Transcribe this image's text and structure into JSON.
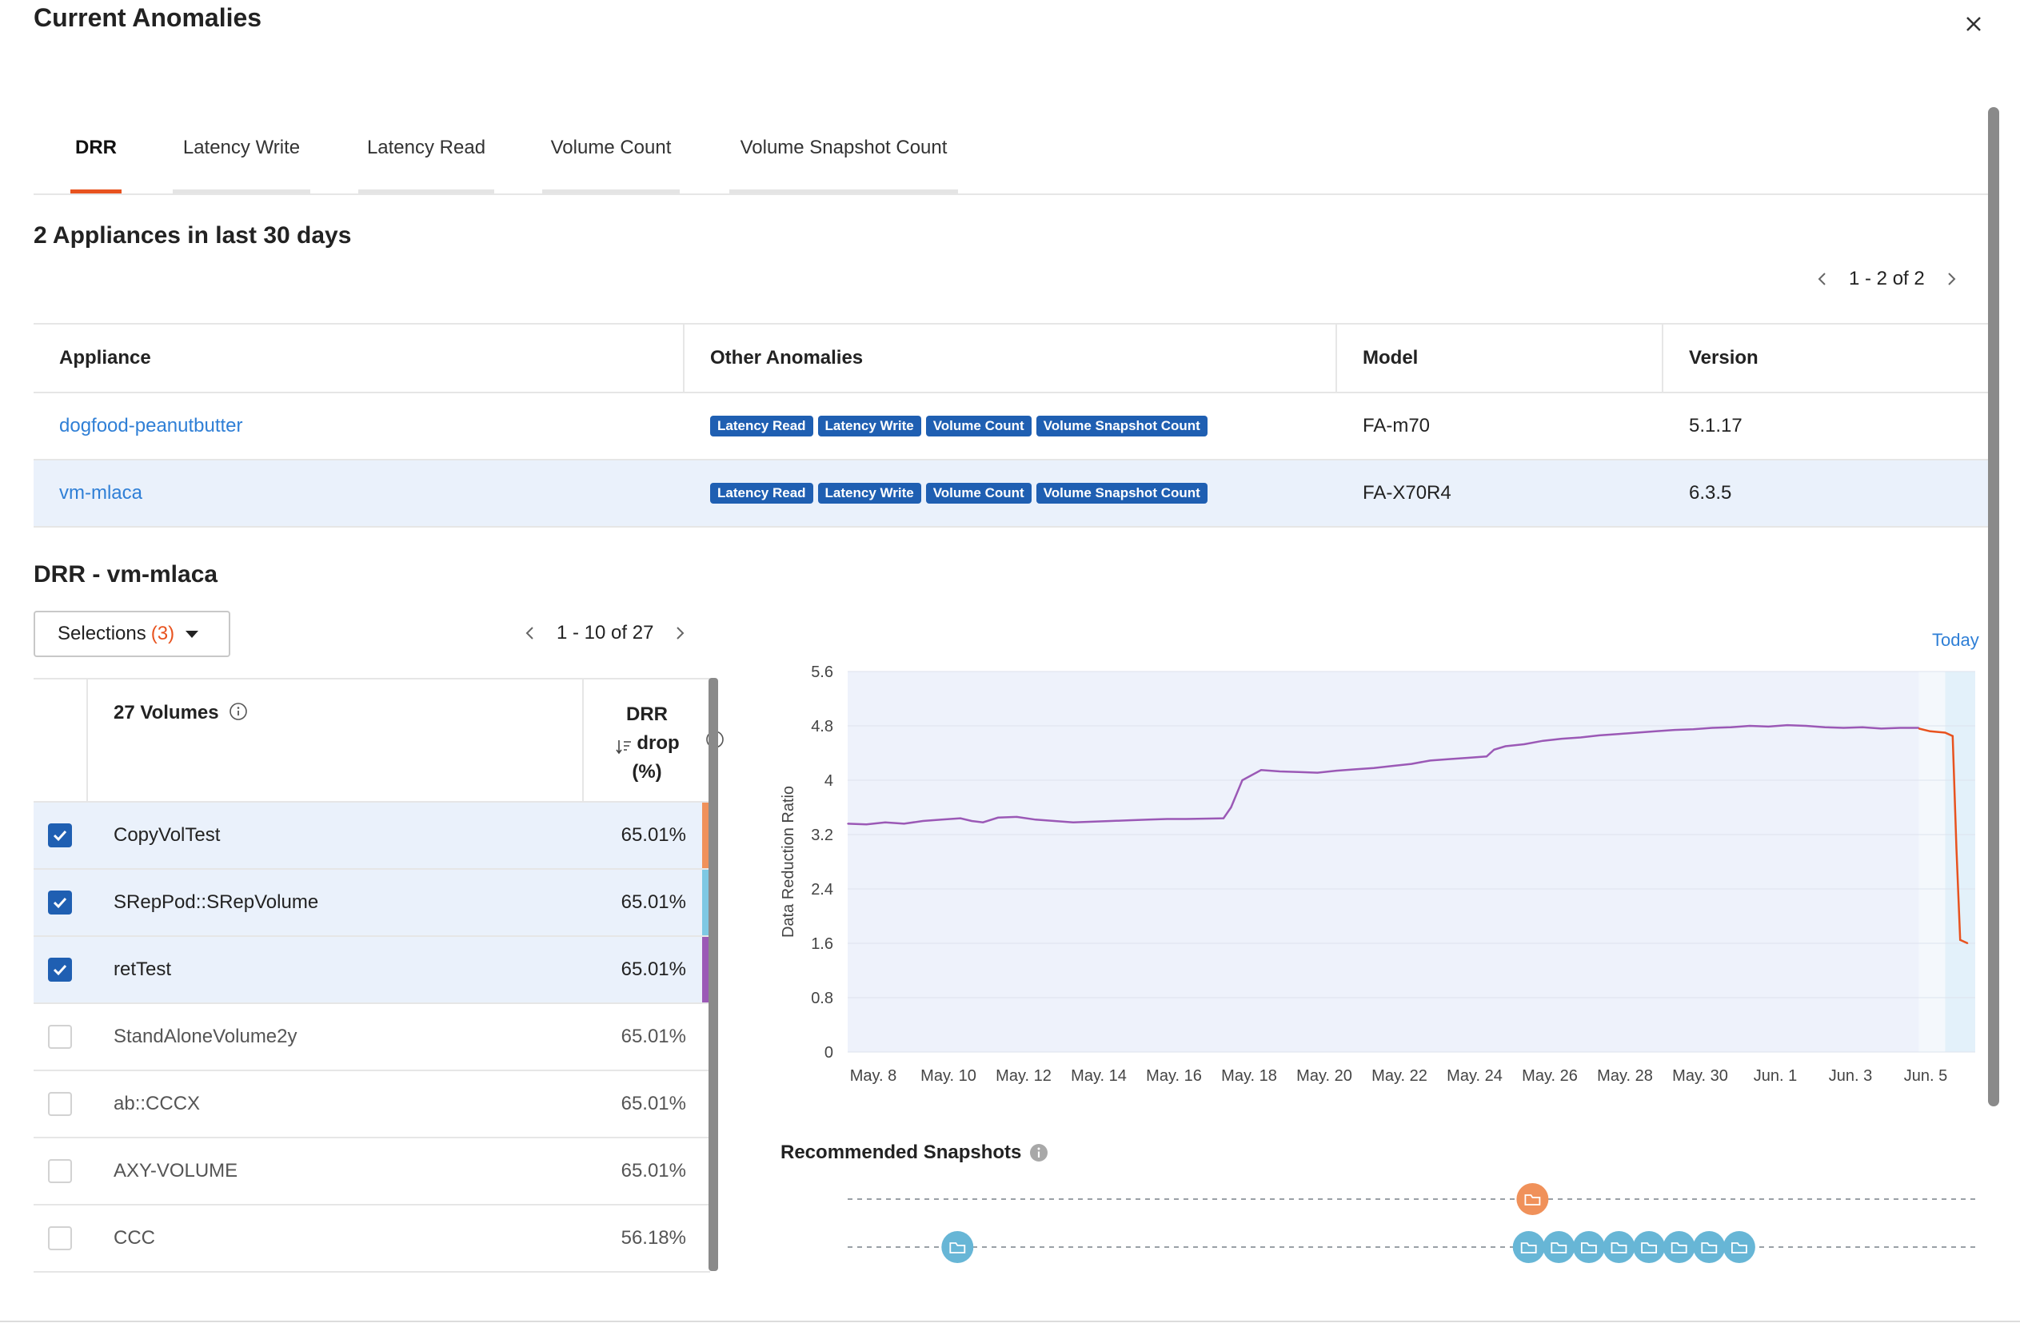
{
  "dialog": {
    "title": "Current Anomalies"
  },
  "tabs": [
    {
      "label": "DRR",
      "active": true
    },
    {
      "label": "Latency Write",
      "active": false
    },
    {
      "label": "Latency Read",
      "active": false
    },
    {
      "label": "Volume Count",
      "active": false
    },
    {
      "label": "Volume Snapshot Count",
      "active": false
    }
  ],
  "appliances": {
    "title": "2 Appliances in last 30 days",
    "pager": "1 - 2 of 2",
    "columns": [
      "Appliance",
      "Other Anomalies",
      "Model",
      "Version"
    ],
    "rows": [
      {
        "name": "dogfood-peanutbutter",
        "badges": [
          "Latency Read",
          "Latency Write",
          "Volume Count",
          "Volume Snapshot Count"
        ],
        "model": "FA-m70",
        "version": "5.1.17",
        "selected": false
      },
      {
        "name": "vm-mlaca",
        "badges": [
          "Latency Read",
          "Latency Write",
          "Volume Count",
          "Volume Snapshot Count"
        ],
        "model": "FA-X70R4",
        "version": "6.3.5",
        "selected": true
      }
    ]
  },
  "detail": {
    "title": "DRR - vm-mlaca",
    "selections": {
      "label": "Selections",
      "count": "(3)"
    },
    "pager": "1 - 10 of 27",
    "volumes_header": "27 Volumes",
    "drr_header": [
      "DRR",
      "drop",
      "(%)"
    ],
    "volumes": [
      {
        "name": "CopyVolTest",
        "value": "65.01%",
        "checked": true,
        "color": "#f0915a"
      },
      {
        "name": "SRepPod::SRepVolume",
        "value": "65.01%",
        "checked": true,
        "color": "#7ec8e3"
      },
      {
        "name": "retTest",
        "value": "65.01%",
        "checked": true,
        "color": "#9b59b6"
      },
      {
        "name": "StandAloneVolume2y",
        "value": "65.01%",
        "checked": false,
        "color": ""
      },
      {
        "name": "ab::CCCX",
        "value": "65.01%",
        "checked": false,
        "color": ""
      },
      {
        "name": "AXY-VOLUME",
        "value": "65.01%",
        "checked": false,
        "color": ""
      },
      {
        "name": "CCC",
        "value": "56.18%",
        "checked": false,
        "color": ""
      }
    ]
  },
  "chart_data": {
    "type": "line",
    "ylabel": "Data Reduction Ratio",
    "xlabel": "",
    "ylim": [
      0,
      5.6
    ],
    "yticks": [
      "5.6",
      "4.8",
      "4",
      "3.2",
      "2.4",
      "1.6",
      "0.8",
      "0"
    ],
    "xticks": [
      "May. 8",
      "May. 10",
      "May. 12",
      "May. 14",
      "May. 16",
      "May. 18",
      "May. 20",
      "May. 22",
      "May. 24",
      "May. 26",
      "May. 28",
      "May. 30",
      "Jun. 1",
      "Jun. 3",
      "Jun. 5"
    ],
    "today_label": "Today",
    "series": [
      {
        "color": "#9b59b6",
        "points": [
          [
            0,
            3.36
          ],
          [
            0.5,
            3.35
          ],
          [
            1,
            3.38
          ],
          [
            1.5,
            3.36
          ],
          [
            2,
            3.4
          ],
          [
            2.5,
            3.42
          ],
          [
            3,
            3.44
          ],
          [
            3.3,
            3.4
          ],
          [
            3.6,
            3.38
          ],
          [
            4,
            3.45
          ],
          [
            4.5,
            3.46
          ],
          [
            5,
            3.42
          ],
          [
            5.5,
            3.4
          ],
          [
            6,
            3.38
          ],
          [
            6.5,
            3.39
          ],
          [
            7,
            3.4
          ],
          [
            7.5,
            3.41
          ],
          [
            8,
            3.42
          ],
          [
            8.5,
            3.43
          ],
          [
            9,
            3.43
          ],
          [
            10,
            3.44
          ],
          [
            10.2,
            3.6
          ],
          [
            10.5,
            4.0
          ],
          [
            11,
            4.15
          ],
          [
            11.5,
            4.13
          ],
          [
            12,
            4.12
          ],
          [
            12.5,
            4.11
          ],
          [
            13,
            4.14
          ],
          [
            13.5,
            4.16
          ],
          [
            14,
            4.18
          ],
          [
            14.5,
            4.21
          ],
          [
            15,
            4.24
          ],
          [
            15.5,
            4.29
          ],
          [
            16,
            4.31
          ],
          [
            16.5,
            4.33
          ],
          [
            17,
            4.35
          ],
          [
            17.2,
            4.45
          ],
          [
            17.5,
            4.5
          ],
          [
            18,
            4.53
          ],
          [
            18.5,
            4.58
          ],
          [
            19,
            4.61
          ],
          [
            19.5,
            4.63
          ],
          [
            20,
            4.66
          ],
          [
            20.5,
            4.68
          ],
          [
            21,
            4.7
          ],
          [
            21.5,
            4.72
          ],
          [
            22,
            4.74
          ],
          [
            22.5,
            4.75
          ],
          [
            23,
            4.77
          ],
          [
            23.5,
            4.78
          ],
          [
            24,
            4.8
          ],
          [
            24.5,
            4.79
          ],
          [
            25,
            4.81
          ],
          [
            25.5,
            4.8
          ],
          [
            26,
            4.78
          ],
          [
            26.5,
            4.77
          ],
          [
            27,
            4.78
          ],
          [
            27.5,
            4.76
          ],
          [
            28,
            4.77
          ],
          [
            28.5,
            4.77
          ]
        ]
      },
      {
        "color": "#e8531f",
        "points": [
          [
            28.5,
            4.76
          ],
          [
            28.8,
            4.72
          ],
          [
            29.2,
            4.7
          ],
          [
            29.4,
            4.65
          ],
          [
            29.5,
            3.0
          ],
          [
            29.6,
            1.65
          ],
          [
            29.8,
            1.6
          ]
        ]
      }
    ]
  },
  "recommended_snapshots": {
    "title": "Recommended Snapshots",
    "tracks": [
      {
        "color": "#f0915a",
        "dates": [
          21.2
        ]
      },
      {
        "color": "#67b6d6",
        "dates": [
          5.9,
          21.1,
          21.9,
          22.7,
          23.5,
          24.3,
          25.1,
          25.9,
          26.7
        ]
      }
    ]
  }
}
